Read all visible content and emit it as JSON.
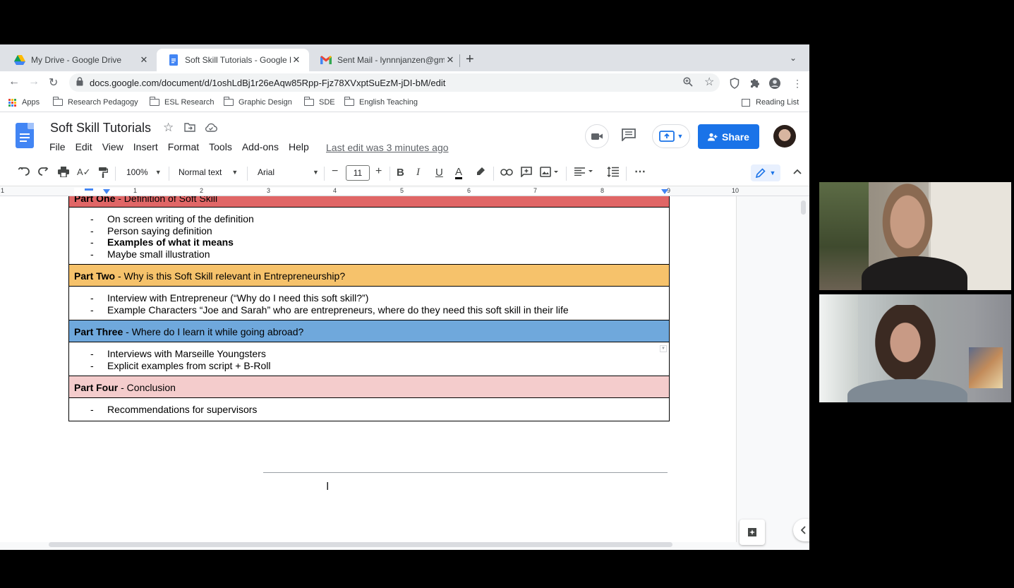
{
  "browser": {
    "tabs": [
      {
        "title": "My Drive - Google Drive",
        "icon": "google-drive-icon",
        "close": "✕"
      },
      {
        "title": "Soft Skill Tutorials - Google Do",
        "icon": "google-docs-icon",
        "close": "✕"
      },
      {
        "title": "Sent Mail - lynnnjanzen@gmail",
        "icon": "gmail-icon",
        "close": "✕"
      }
    ],
    "new_tab": "+",
    "tab_list": "⌄",
    "url": "docs.google.com/document/d/1oshLdBj1r26eAqw85Rpp-Fjz78XVxptSuEzM-jDI-bM/edit",
    "bookmarks": [
      "Apps",
      "Research Pedagogy",
      "ESL Research",
      "Graphic Design",
      "SDE",
      "English Teaching"
    ],
    "reading_list": "Reading List"
  },
  "docs": {
    "title": "Soft Skill Tutorials",
    "menu": [
      "File",
      "Edit",
      "View",
      "Insert",
      "Format",
      "Tools",
      "Add-ons",
      "Help"
    ],
    "last_edit": "Last edit was 3 minutes ago",
    "share_label": "Share"
  },
  "toolbar": {
    "zoom": "100%",
    "style": "Normal text",
    "font": "Arial",
    "font_size": "11",
    "bold": "B",
    "italic": "I",
    "underline": "U",
    "text_color": "A",
    "more": "⋯"
  },
  "ruler": {
    "numbers": [
      "1",
      "1",
      "2",
      "3",
      "4",
      "5",
      "6",
      "7",
      "8",
      "9",
      "10"
    ]
  },
  "document": {
    "sections": [
      {
        "title": "Part One",
        "subtitle": " - Definition of Soft Skill",
        "color": "#e06666",
        "items": [
          {
            "text": "On screen writing of the definition",
            "bold": false
          },
          {
            "text": "Person saying definition",
            "bold": false
          },
          {
            "text": "Examples of what it means",
            "bold": true
          },
          {
            "text": "Maybe small illustration",
            "bold": false
          }
        ]
      },
      {
        "title": "Part Two",
        "subtitle": " - Why is this Soft Skill relevant in Entrepreneurship?",
        "color": "#f6c26b",
        "items": [
          {
            "text": "Interview with Entrepreneur (“Why do I need this soft skill?”)",
            "bold": false
          },
          {
            "text": "Example Characters “Joe and Sarah” who are entrepreneurs, where do they need this soft skill in their life",
            "bold": false
          }
        ]
      },
      {
        "title": "Part Three",
        "subtitle": " - Where do I learn it while going abroad?",
        "color": "#6fa8dc",
        "items": [
          {
            "text": "Interviews with Marseille Youngsters",
            "bold": false
          },
          {
            "text": "Explicit examples from script + B-Roll",
            "bold": false
          }
        ]
      },
      {
        "title": "Part Four",
        "subtitle": " - Conclusion",
        "color": "#f4cccc",
        "items": [
          {
            "text": "Recommendations for supervisors",
            "bold": false
          }
        ]
      }
    ]
  },
  "colors": {
    "accent": "#1a73e8",
    "docs_blue": "#4285f4"
  }
}
